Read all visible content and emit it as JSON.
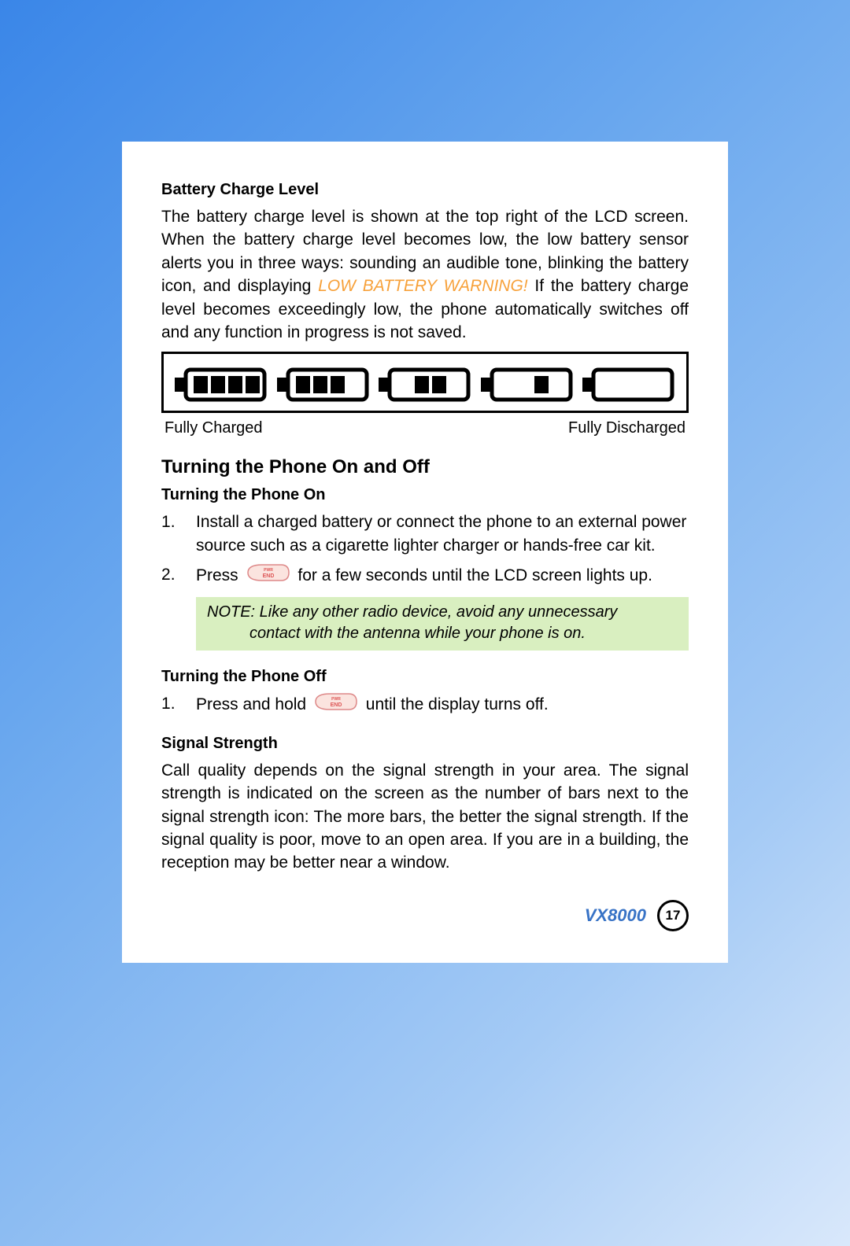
{
  "battery": {
    "heading": "Battery Charge Level",
    "para_a": "The battery charge level is shown at the top right of the LCD screen. When the battery charge level becomes low, the low battery sensor alerts you in three ways: sounding an audible tone, blinking the battery icon, and displaying ",
    "warning": "LOW BATTERY WARNING!",
    "para_b": " If the battery charge level becomes exceedingly low, the phone automatically switches off and any function in progress is not saved.",
    "label_full": "Fully Charged",
    "label_empty": "Fully Discharged"
  },
  "power": {
    "section": "Turning the Phone On and Off",
    "on_heading": "Turning the Phone On",
    "on_steps": [
      "Install a charged battery or connect the phone to an external power source such as a cigarette lighter charger or hands-free car kit.",
      {
        "pre": "Press ",
        "post": " for a few seconds until the LCD screen lights up."
      }
    ],
    "note_a": "NOTE: Like any other radio device, avoid any unnecessary",
    "note_b": "contact with the antenna while your phone is on.",
    "off_heading": "Turning the Phone Off",
    "off_step_pre": "Press and hold ",
    "off_step_post": " until the display turns off."
  },
  "signal": {
    "heading": "Signal Strength",
    "para": "Call quality depends on the signal strength in your area. The signal strength is indicated on the screen as the number of bars next to the signal strength icon: The more bars, the better the signal strength. If the signal quality is poor, move to an open area. If you are in a building, the reception may be better near a window."
  },
  "footer": {
    "model": "VX8000",
    "page": "17"
  }
}
